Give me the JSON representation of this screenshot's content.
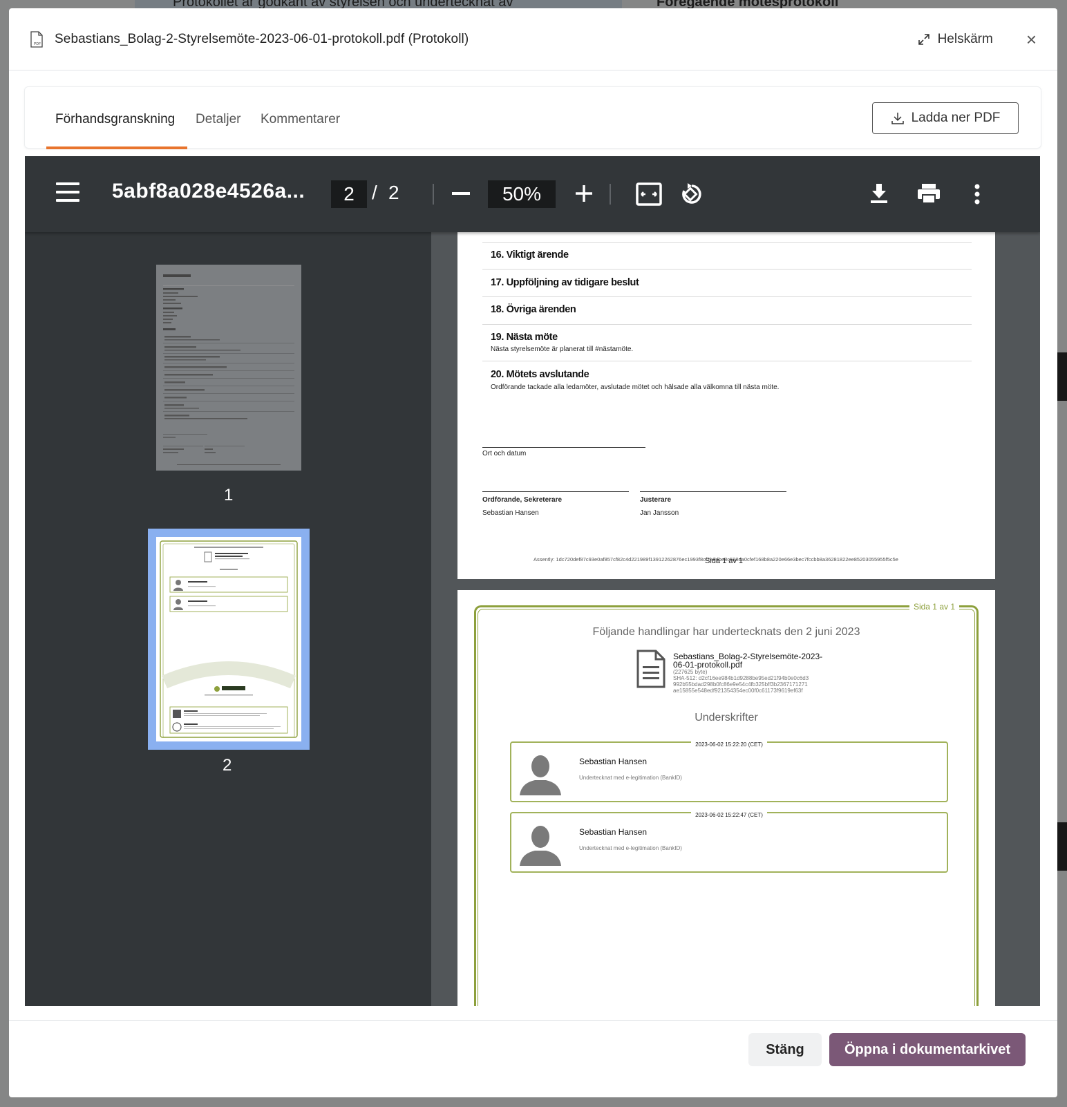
{
  "background": {
    "banner_text": "Protokollet är godkänt av styrelsen och undertecknat av",
    "right_text": "Föregående mötesprotokoll"
  },
  "modal": {
    "title": "Sebastians_Bolag-2-Styrelsemöte-2023-06-01-protokoll.pdf (Protokoll)",
    "file_icon": "pdf-file-icon",
    "fullscreen_label": "Helskärm",
    "close_label": "×"
  },
  "tabs": [
    {
      "label": "Förhandsgranskning",
      "active": true
    },
    {
      "label": "Detaljer",
      "active": false
    },
    {
      "label": "Kommentarer",
      "active": false
    }
  ],
  "download_pdf_label": "Ladda ner PDF",
  "viewer": {
    "doc_name": "5abf8a028e4526a...",
    "current_page": "2",
    "page_separator": "/",
    "total_pages": "2",
    "zoom": "50%",
    "thumbnails": [
      {
        "number": "1",
        "selected": false
      },
      {
        "number": "2",
        "selected": true
      }
    ]
  },
  "page1": {
    "agenda": [
      {
        "title": "16. Viktigt ärende",
        "desc": ""
      },
      {
        "title": "17. Uppföljning av tidigare beslut",
        "desc": ""
      },
      {
        "title": "18. Övriga ärenden",
        "desc": ""
      },
      {
        "title": "19. Nästa möte",
        "desc": "Nästa styrelsemöte är planerat till #nästamöte."
      },
      {
        "title": "20. Mötets avslutande",
        "desc": "Ordförande tackade alla ledamöter, avslutade mötet och hälsade alla välkomna till nästa möte."
      }
    ],
    "place_date_label": "Ort och datum",
    "signer1_role": "Ordförande, Sekreterare",
    "signer1_name": "Sebastian Hansen",
    "signer2_role": "Justerare",
    "signer2_name": "Jan Jansson",
    "hash_footer": "Assently: 1dc720def87c93e0af857cf82c4d221989f13912262876ec1993f8cf2e8dbe8c588da0cfef168b8a220e66e3bec7fccbb8a36281822ee85203055955f5c5e",
    "page_number": "Sida 1 av 1"
  },
  "page2": {
    "page_number": "Sida 1 av 1",
    "heading": "Följande handlingar har undertecknats den 2 juni 2023",
    "doc_name": "Sebastians_Bolag-2-Styrelsemöte-2023-06-01-protokoll.pdf",
    "doc_size": "(227625 byte)",
    "doc_hash_1": "SHA-512: d2cf16ee984b1d9288be95ed21f94b0e0c6d3",
    "doc_hash_2": "992b55bdad298b0fc86e9e54c4fb325bff3b2367171271",
    "doc_hash_3": "ae15855e548edf921354354ec00f0c61173f9619ef63f",
    "signatures_heading": "Underskrifter",
    "signatures": [
      {
        "timestamp": "2023-06-02 15:22:20 (CET)",
        "name": "Sebastian Hansen",
        "method": "Undertecknat med e-legitimation (BankID)"
      },
      {
        "timestamp": "2023-06-02 15:22:47 (CET)",
        "name": "Sebastian Hansen",
        "method": "Undertecknat med e-legitimation (BankID)"
      }
    ]
  },
  "footer": {
    "close_label": "Stäng",
    "open_archive_label": "Öppna i dokumentarkivet"
  },
  "colors": {
    "accent_tab": "#e8742d",
    "primary_button": "#7b5877",
    "certificate_green": "#8da03c",
    "viewer_toolbar": "#323639"
  }
}
